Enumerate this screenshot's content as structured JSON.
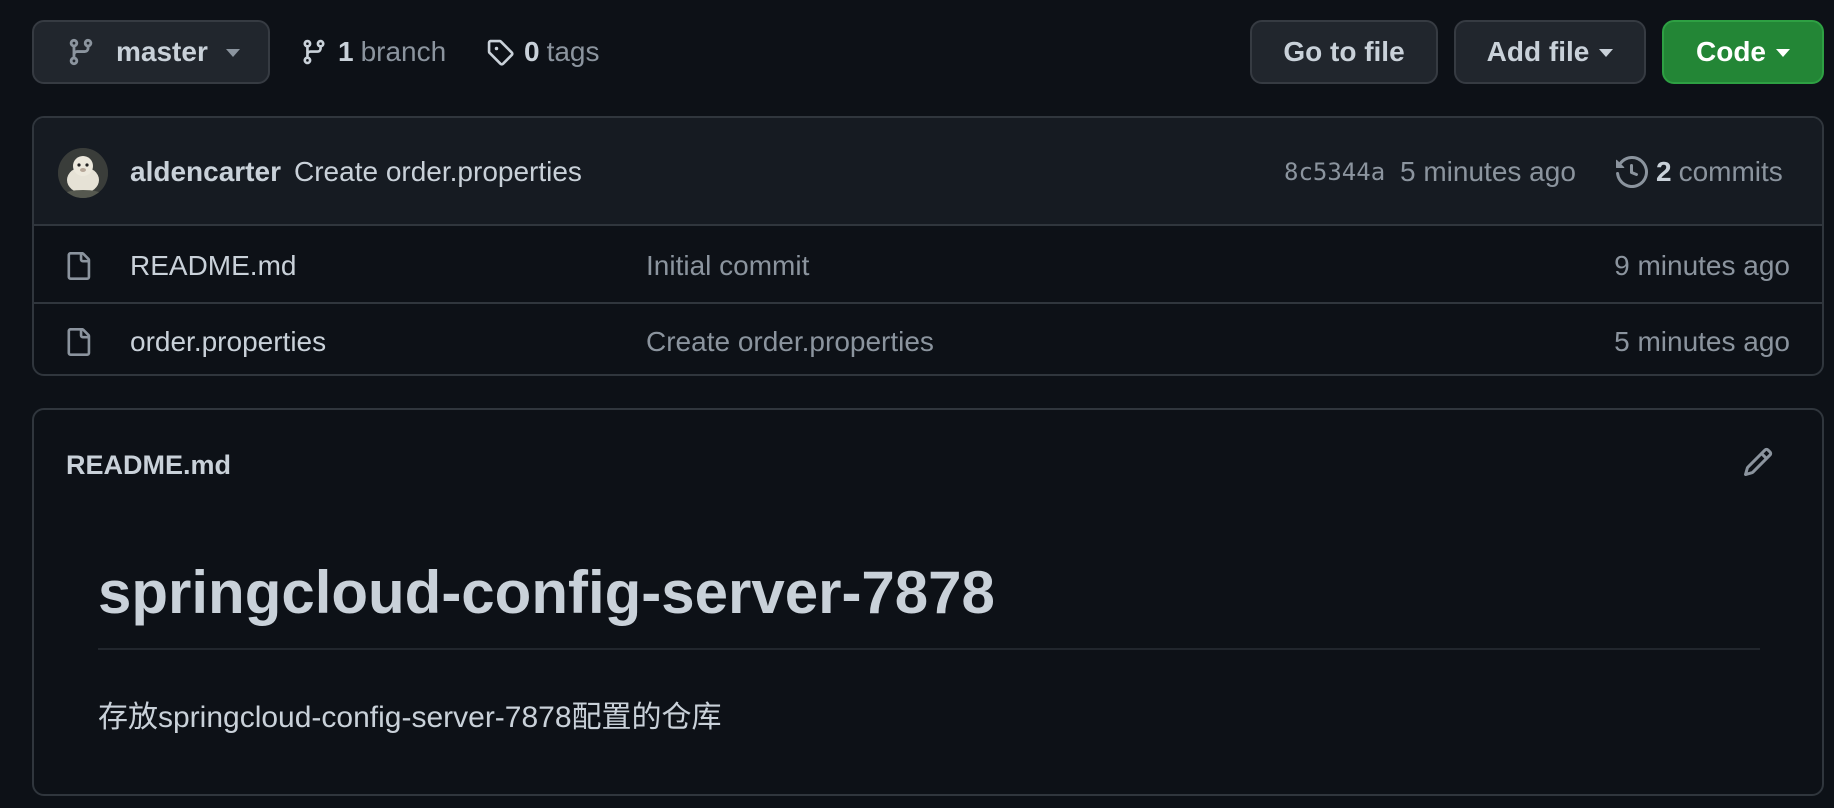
{
  "toolbar": {
    "branch_selector": {
      "label": "master",
      "icon": "git-branch-icon"
    },
    "branches": {
      "count": "1",
      "label": "branch",
      "icon": "git-branch-icon"
    },
    "tags": {
      "count": "0",
      "label": "tags",
      "icon": "tag-icon"
    },
    "go_to_file": "Go to file",
    "add_file": "Add file",
    "code": "Code"
  },
  "latest_commit": {
    "author": "aldencarter",
    "message": "Create order.properties",
    "sha": "8c5344a",
    "time": "5 minutes ago",
    "commit_count": "2",
    "commit_label": "commits",
    "icon": "history-icon"
  },
  "files": [
    {
      "name": "README.md",
      "message": "Initial commit",
      "time": "9 minutes ago",
      "icon": "file-icon"
    },
    {
      "name": "order.properties",
      "message": "Create order.properties",
      "time": "5 minutes ago",
      "icon": "file-icon"
    }
  ],
  "readme": {
    "title": "README.md",
    "heading": "springcloud-config-server-7878",
    "paragraph": "存放springcloud-config-server-7878配置的仓库",
    "edit_icon": "pencil-icon"
  },
  "colors": {
    "background": "#0d1117",
    "panel": "#161b22",
    "border": "#30363d",
    "text": "#c9d1d9",
    "muted": "#8b949e",
    "primary_button": "#238636"
  }
}
